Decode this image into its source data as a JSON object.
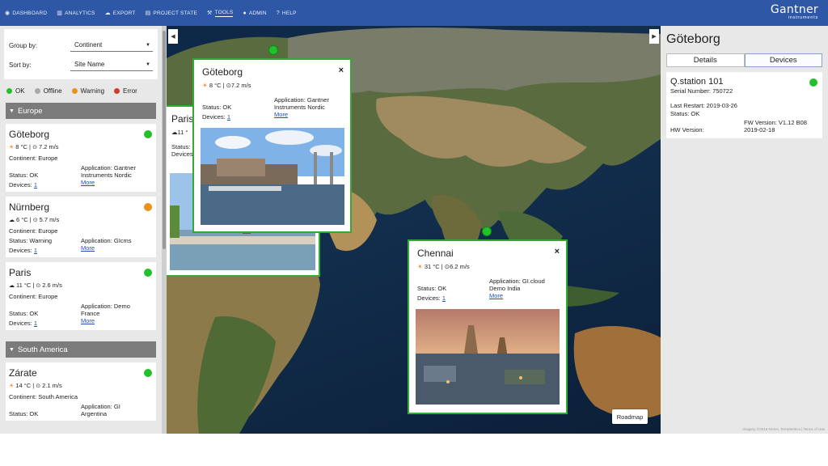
{
  "nav": {
    "items": [
      {
        "label": "DASHBOARD",
        "icon": "dashboard-icon",
        "glyph": "◉"
      },
      {
        "label": "ANALYTICS",
        "icon": "chart-icon",
        "glyph": "▥"
      },
      {
        "label": "EXPORT",
        "icon": "cloud-icon",
        "glyph": "☁"
      },
      {
        "label": "PROJECT STATE",
        "icon": "list-icon",
        "glyph": "▤"
      },
      {
        "label": "TOOLS",
        "icon": "wrench-icon",
        "glyph": "⚒"
      },
      {
        "label": "ADMIN",
        "icon": "user-icon",
        "glyph": "●"
      },
      {
        "label": "HELP",
        "icon": "help-icon",
        "glyph": "?"
      }
    ],
    "brand": "Gantner",
    "brand_sub": "instruments",
    "accent": "#2e57a6"
  },
  "filters": {
    "group_label": "Group by:",
    "group_value": "Continent",
    "sort_label": "Sort by:",
    "sort_value": "Site Name"
  },
  "legend": [
    {
      "label": "OK",
      "color": "#22c02a"
    },
    {
      "label": "Offline",
      "color": "#a8a8a8"
    },
    {
      "label": "Warning",
      "color": "#e8931d"
    },
    {
      "label": "Error",
      "color": "#d23b2c"
    }
  ],
  "groups": [
    {
      "name": "Europe",
      "sites": [
        {
          "name": "Göteborg",
          "status_color": "#22c02a",
          "temp": "8 °C |",
          "wind": "7.2 m/s",
          "continent": "Continent: Europe",
          "status": "Status: OK",
          "devices_label": "Devices:",
          "devices": "1",
          "app_line1": "Application: Gantner",
          "app_line2": "Instruments Nordic",
          "more": "More"
        },
        {
          "name": "Nürnberg",
          "status_color": "#e8931d",
          "temp": "6 °C |",
          "wind": "5.7 m/s",
          "continent": "Continent: Europe",
          "status": "Status: Warning",
          "devices_label": "Devices:",
          "devices": "1",
          "app_line1": "Application: GIcms",
          "app_line2": "",
          "more": "More"
        },
        {
          "name": "Paris",
          "status_color": "#22c02a",
          "temp": "11 °C |",
          "wind": "2.6 m/s",
          "continent": "Continent: Europe",
          "status": "Status: OK",
          "devices_label": "Devices:",
          "devices": "1",
          "app_line1": "Application: Demo",
          "app_line2": "France",
          "more": "More"
        }
      ]
    },
    {
      "name": "South America",
      "sites": [
        {
          "name": "Zárate",
          "status_color": "#22c02a",
          "temp": "14 °C |",
          "wind": "2.1 m/s",
          "continent": "Continent: South America",
          "status": "Status: OK",
          "devices_label": "Devices:",
          "devices": "1",
          "app_line1": "Application: GI",
          "app_line2": "Argentina",
          "more": "More"
        }
      ]
    }
  ],
  "map": {
    "roadmap_label": "Roadmap",
    "popup_gote": {
      "name": "Göteborg",
      "temp": "8 °C |",
      "wind": "7.2 m/s",
      "status": "Status: OK",
      "devices_label": "Devices:",
      "devices": "1",
      "app_line1": "Application: Gantner",
      "app_line2": "Instruments Nordic",
      "more": "More",
      "close": "×"
    },
    "popup_chennai": {
      "name": "Chennai",
      "temp": "31 °C |",
      "wind": "6.2 m/s",
      "status": "Status: OK",
      "devices_label": "Devices:",
      "devices": "1",
      "app_line1": "Application: GI.cloud",
      "app_line2": "Demo India",
      "more": "More",
      "close": "×"
    },
    "popup_paris": {
      "name": "Paris",
      "temp": "11 °",
      "status": "Status:",
      "devices_label": "Devices:"
    },
    "copyright": "Imagery ©2019 NASA, TerraMetrics | Terms of Use"
  },
  "detail": {
    "title": "Göteborg",
    "tabs": [
      "Details",
      "Devices"
    ],
    "device": {
      "name": "Q.station 101",
      "status_color": "#22c02a",
      "serial": "Serial Number: 750722",
      "last_restart": "Last Restart: 2019-03-26",
      "status": "Status: OK",
      "fw": "FW Version: V1.12 B08",
      "hw_label": "HW Version:",
      "hw_date": "2019-02-18"
    }
  }
}
